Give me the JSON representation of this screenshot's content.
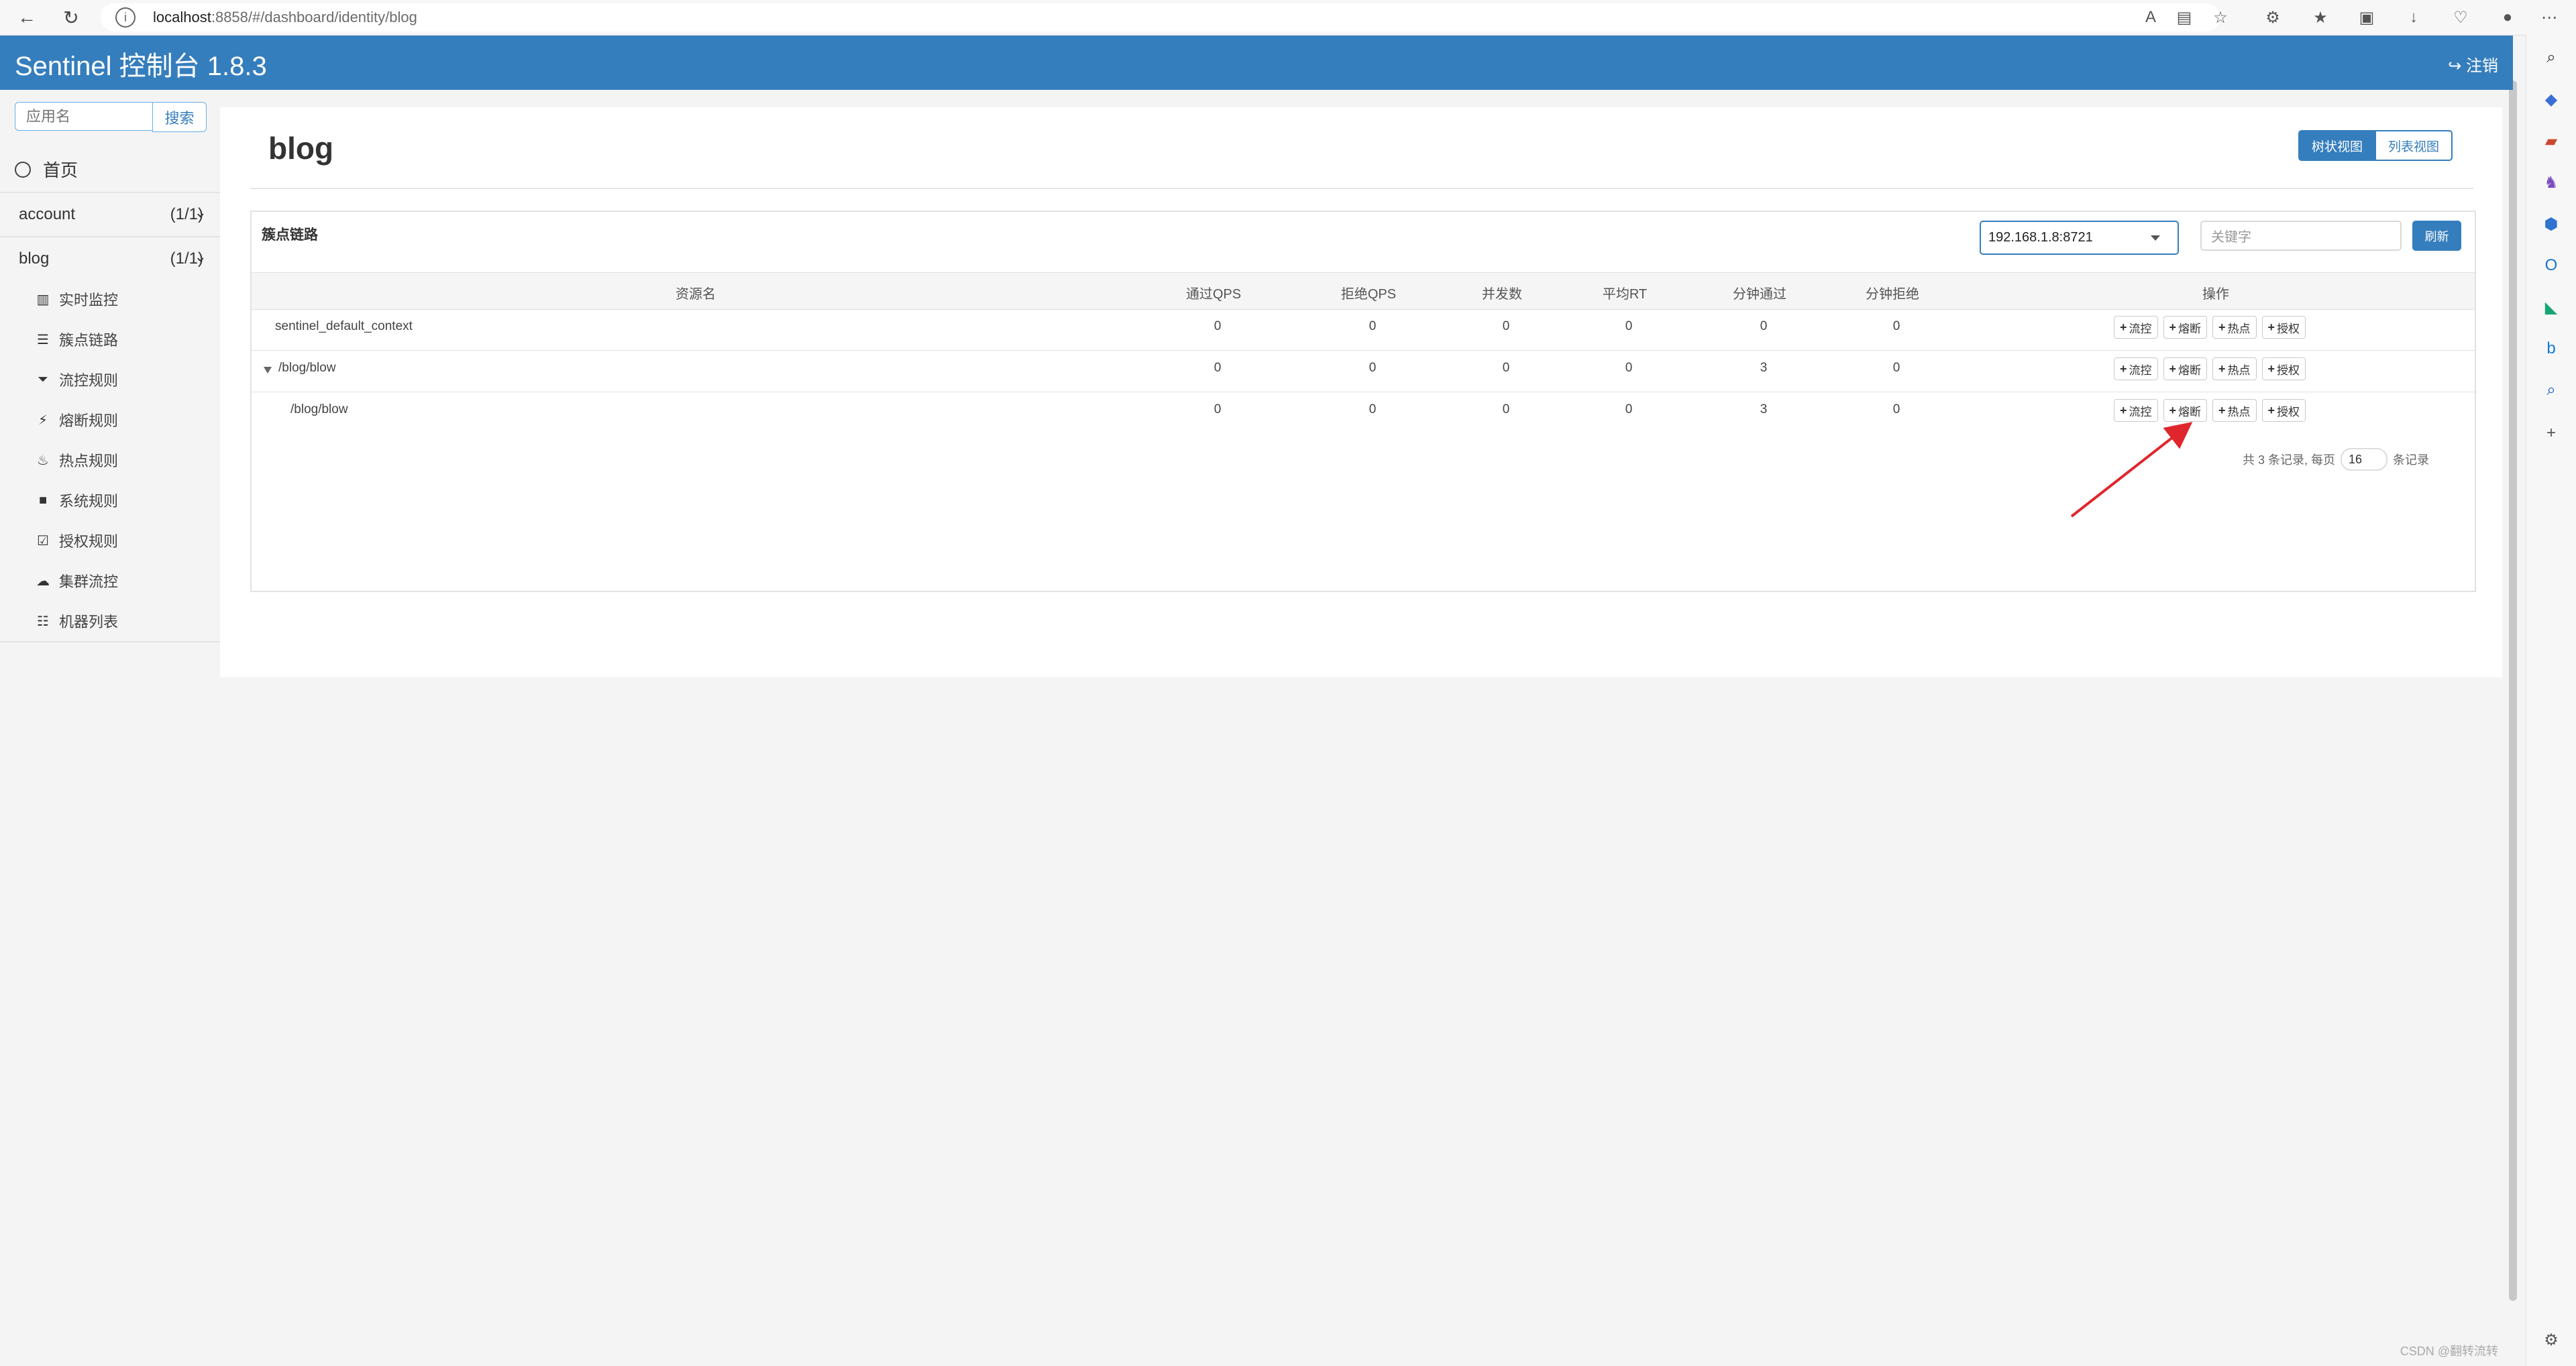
{
  "browser": {
    "url_host": "localhost",
    "url_path": ":8858/#/dashboard/identity/blog"
  },
  "header": {
    "brand": "Sentinel 控制台 1.8.3",
    "logout": "注销"
  },
  "sidebar": {
    "search_placeholder": "应用名",
    "search_button": "搜索",
    "home": "首页",
    "apps": [
      {
        "name": "account",
        "count": "(1/1)"
      },
      {
        "name": "blog",
        "count": "(1/1)"
      }
    ],
    "menu": [
      "实时监控",
      "簇点链路",
      "流控规则",
      "熔断规则",
      "热点规则",
      "系统规则",
      "授权规则",
      "集群流控",
      "机器列表"
    ]
  },
  "page": {
    "title": "blog",
    "tree_view": "树状视图",
    "list_view": "列表视图",
    "panel_title": "簇点链路",
    "machine": "192.168.1.8:8721",
    "keyword_placeholder": "关键字",
    "refresh": "刷新"
  },
  "table": {
    "columns": [
      "资源名",
      "通过QPS",
      "拒绝QPS",
      "并发数",
      "平均RT",
      "分钟通过",
      "分钟拒绝",
      "操作"
    ],
    "rows": [
      {
        "resource": "sentinel_default_context",
        "pass_qps": "0",
        "block_qps": "0",
        "threads": "0",
        "avg_rt": "0",
        "minute_pass": "0",
        "minute_block": "0"
      },
      {
        "resource": "/blog/blow",
        "pass_qps": "0",
        "block_qps": "0",
        "threads": "0",
        "avg_rt": "0",
        "minute_pass": "3",
        "minute_block": "0"
      },
      {
        "resource": "/blog/blow",
        "pass_qps": "0",
        "block_qps": "0",
        "threads": "0",
        "avg_rt": "0",
        "minute_pass": "3",
        "minute_block": "0"
      }
    ],
    "actions": [
      "流控",
      "熔断",
      "热点",
      "授权"
    ]
  },
  "pagination": {
    "summary": "共 3 条记录, 每页",
    "page_size": "16",
    "suffix": "条记录"
  },
  "watermark": "CSDN @翻转流转",
  "colors": {
    "brand": "#357ebd",
    "arrow": "#e0262d"
  }
}
